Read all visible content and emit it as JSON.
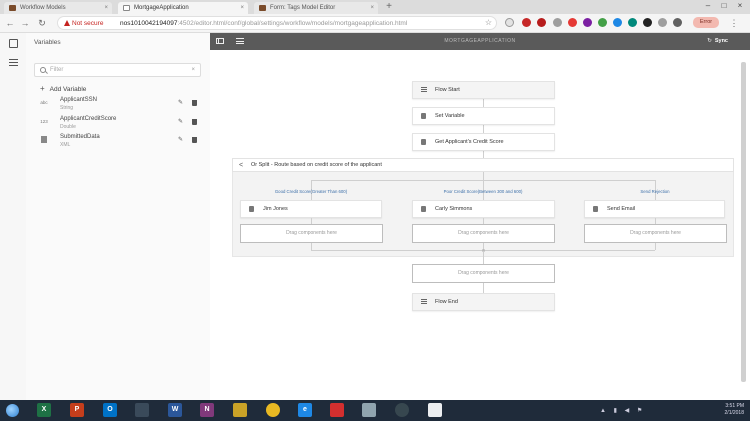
{
  "browser": {
    "tabs": [
      {
        "title": "Workflow Models",
        "active": false
      },
      {
        "title": "MortgageApplication",
        "active": true
      },
      {
        "title": "Form: Tags Model Editor",
        "active": false
      }
    ],
    "security_label": "Not secure",
    "url_host": "nos1010042194097",
    "url_rest": ":4502/editor.html/conf/global/settings/workflow/models/mortgageapplication.html",
    "profile_label": "Error"
  },
  "variables_panel": {
    "title": "Variables",
    "filter_placeholder": "Filter",
    "filter_clear": "×",
    "add_label": "Add Variable",
    "items": [
      {
        "type_icon": "abc",
        "name": "ApplicantSSN",
        "type": "String"
      },
      {
        "type_icon": "123",
        "name": "ApplicantCreditScore",
        "type": "Double"
      },
      {
        "type_icon": "doc",
        "name": "SubmittedData",
        "type": "XML"
      }
    ]
  },
  "toolbar": {
    "title": "MORTGAGEAPPLICATION",
    "sync_label": "Sync"
  },
  "flow": {
    "start": "Flow Start",
    "set_variable": "Set Variable",
    "get_score": "Get Applicant's Credit Score",
    "split_title": "Or Split - Route based on credit score of the applicant",
    "branches": [
      {
        "label": "Good Credit Score(Greater Than 600)",
        "step": "Jim Jones",
        "drop": "Drag components here"
      },
      {
        "label": "Poor Credit Score(Between 300 and 600)",
        "step": "Carly Simmons",
        "drop": "Drag components here"
      },
      {
        "label": "Send Rejection",
        "step": "Send Email",
        "drop": "Drag components here"
      }
    ],
    "after_drop": "Drag components here",
    "end": "Flow End"
  },
  "taskbar": {
    "time": "3:51 PM",
    "date": "2/1/2018",
    "apps": [
      "X",
      "P",
      "O",
      "",
      "W",
      "N",
      "",
      "",
      "e",
      "",
      "",
      "",
      ""
    ]
  },
  "colors": {
    "toolbar": "#5a5a5a",
    "branch_label": "#3b6ea8",
    "not_secure": "#c5221f",
    "taskbar": "#1f2b3a"
  }
}
